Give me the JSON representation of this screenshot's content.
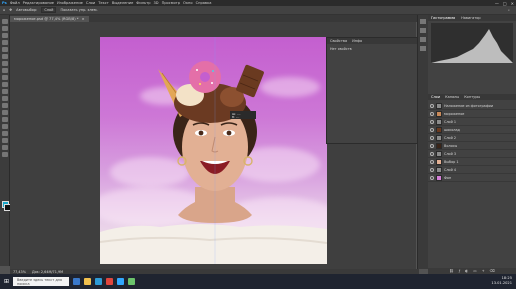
{
  "menu": [
    "Ps",
    "Файл",
    "Редактирование",
    "Изображение",
    "Слои",
    "Текст",
    "Выделение",
    "Фильтр",
    "3D",
    "Просмотр",
    "Окно",
    "Справка"
  ],
  "window_controls": [
    "—",
    "□",
    "✕"
  ],
  "options": {
    "auto_select": "Автовыбор:",
    "layer": "Слой",
    "transform": "Показать упр. элем."
  },
  "document_tab": {
    "title": "мороженое.psd @ 77,4% (RGB/8) *",
    "close": "×"
  },
  "status": {
    "zoom": "77,43%",
    "doc": "Док: 2,64M/71,9M"
  },
  "properties": {
    "tabs": [
      "Свойства",
      "Инфо"
    ],
    "subtitle": "Нет свойств"
  },
  "right_panel": {
    "tabs": [
      "Гистограмма",
      "Навигатор"
    ],
    "layer_tabs": [
      "Слои",
      "Каналы",
      "Контуры"
    ],
    "layers": [
      {
        "name": "Наложение из фотографии"
      },
      {
        "name": "мороженое"
      },
      {
        "name": "Слой 1"
      },
      {
        "name": "шоколад"
      },
      {
        "name": "Слой 2"
      },
      {
        "name": "Волосы"
      },
      {
        "name": "Слой 3"
      },
      {
        "name": "Выбор 1"
      },
      {
        "name": "Слой 4"
      },
      {
        "name": "Фон"
      }
    ]
  },
  "taskbar": {
    "search_placeholder": "Введите здесь текст для поиска",
    "time": "18:25",
    "date": "13.01.2021"
  },
  "icons": [
    "search-icon",
    "gear-icon",
    "eye-icon",
    "windows-icon"
  ],
  "colors": {
    "accent": "#31a8ff",
    "canvas_top": "#c45fcf",
    "canvas_bottom": "#f2ece8"
  }
}
